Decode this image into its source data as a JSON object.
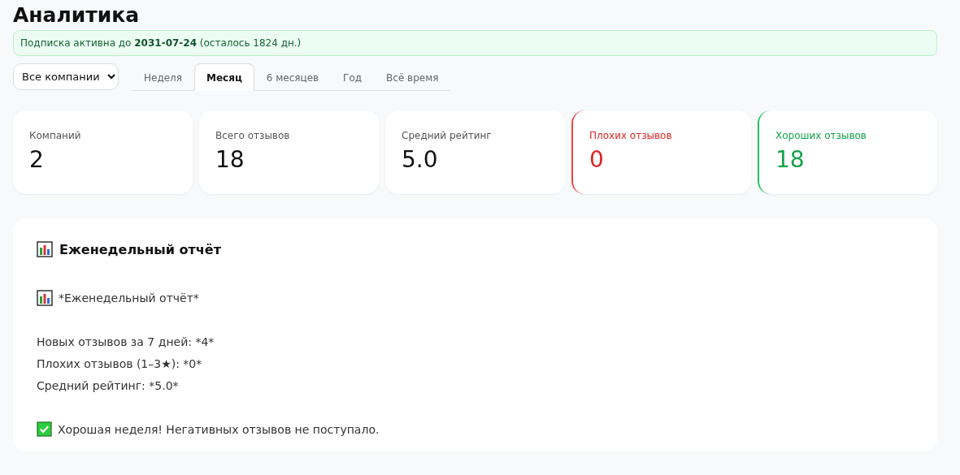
{
  "page": {
    "title": "Аналитика"
  },
  "subscription": {
    "text": "Подписка активна до **2031-07-24** (осталось 1824 дн.)"
  },
  "company_filter": {
    "value": "Все компании"
  },
  "period_tabs": [
    {
      "label": "Неделя",
      "selected": false
    },
    {
      "label": "Месяц",
      "selected": true
    },
    {
      "label": "6 месяцев",
      "selected": false
    },
    {
      "label": "Год",
      "selected": false
    },
    {
      "label": "Всё время",
      "selected": false
    }
  ],
  "stats": [
    {
      "label": "Компаний",
      "value": "2",
      "kind": "neutral"
    },
    {
      "label": "Всего отзывов",
      "value": "18",
      "kind": "neutral"
    },
    {
      "label": "Средний рейтинг",
      "value": "5.0",
      "kind": "neutral"
    },
    {
      "label": "Плохих отзывов",
      "value": "0",
      "kind": "bad"
    },
    {
      "label": "Хороших отзывов",
      "value": "18",
      "kind": "good"
    }
  ],
  "report": {
    "title": "Еженедельный отчёт",
    "lines": [
      {
        "kind": "chart",
        "text": "*Еженедельный отчёт*"
      },
      {
        "kind": "gap"
      },
      {
        "kind": "plain",
        "text": "Новых отзывов за 7 дней: *4*"
      },
      {
        "kind": "plain",
        "text": "Плохих отзывов (1–3★): *0*"
      },
      {
        "kind": "plain",
        "text": "Средний рейтинг: *5.0*"
      },
      {
        "kind": "gap"
      },
      {
        "kind": "check",
        "text": "Хорошая неделя! Негативных отзывов не поступало."
      }
    ]
  }
}
